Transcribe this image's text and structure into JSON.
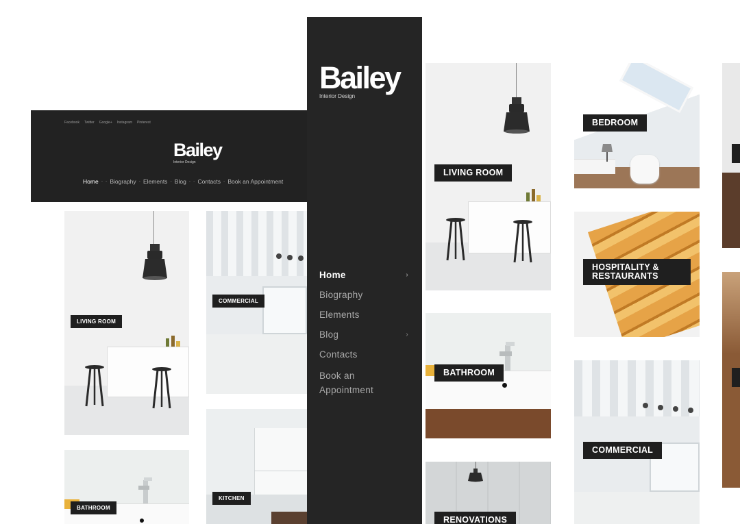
{
  "left_site": {
    "social": [
      "Facebook",
      "Twitter",
      "Google+",
      "Instagram",
      "Pinterest"
    ],
    "logo": "Bailey",
    "tagline": "Interior Design",
    "nav": [
      "Home",
      "Biography",
      "Elements",
      "Blog",
      "Contacts",
      "Book an Appointment"
    ],
    "tiles": [
      "LIVING ROOM",
      "COMMERCIAL",
      "BATHROOM",
      "KITCHEN"
    ]
  },
  "sidebar": {
    "logo": "Bailey",
    "tagline": "Interior Design",
    "nav": [
      {
        "label": "Home",
        "chevron": "›"
      },
      {
        "label": "Biography"
      },
      {
        "label": "Elements"
      },
      {
        "label": "Blog",
        "chevron": "›"
      },
      {
        "label": "Contacts"
      },
      {
        "label": "Book an Appointment"
      }
    ]
  },
  "gallery": {
    "tiles": [
      "LIVING ROOM",
      "BEDROOM",
      "HOSPITALITY & RESTAURANTS",
      "BATHROOM",
      "COMMERCIAL",
      "RENOVATIONS"
    ]
  },
  "colors": {
    "dark": "#222222",
    "sidebar": "#252525",
    "label_bg": "#1f1f1f",
    "wood": "#d9952e"
  }
}
